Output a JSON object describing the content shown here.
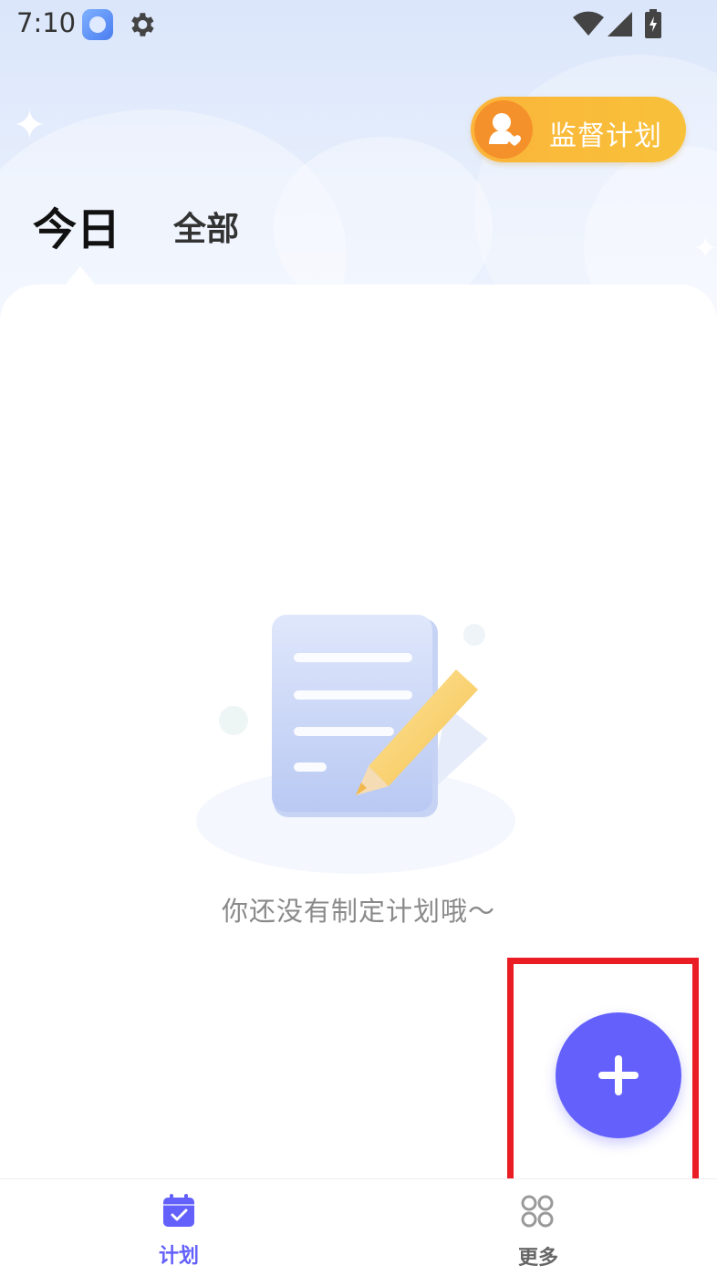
{
  "status_bar": {
    "time": "7:10",
    "icons": [
      "app-notification-icon",
      "gear-icon",
      "wifi-icon",
      "signal-icon",
      "battery-icon"
    ]
  },
  "header": {
    "supervise_button_label": "监督计划",
    "tabs": [
      {
        "label": "今日",
        "active": true
      },
      {
        "label": "全部",
        "active": false
      }
    ]
  },
  "empty_state": {
    "message": "你还没有制定计划哦～",
    "illustration": "document-pencil-icon"
  },
  "fab": {
    "icon": "plus-icon",
    "color": "#6360fb"
  },
  "bottom_nav": {
    "items": [
      {
        "label": "计划",
        "icon": "calendar-check-icon",
        "active": true
      },
      {
        "label": "更多",
        "icon": "grid-icon",
        "active": false
      }
    ]
  },
  "colors": {
    "accent": "#6360fb",
    "supervise_button": "#f8c13a",
    "highlight_box": "#ea1c24"
  }
}
